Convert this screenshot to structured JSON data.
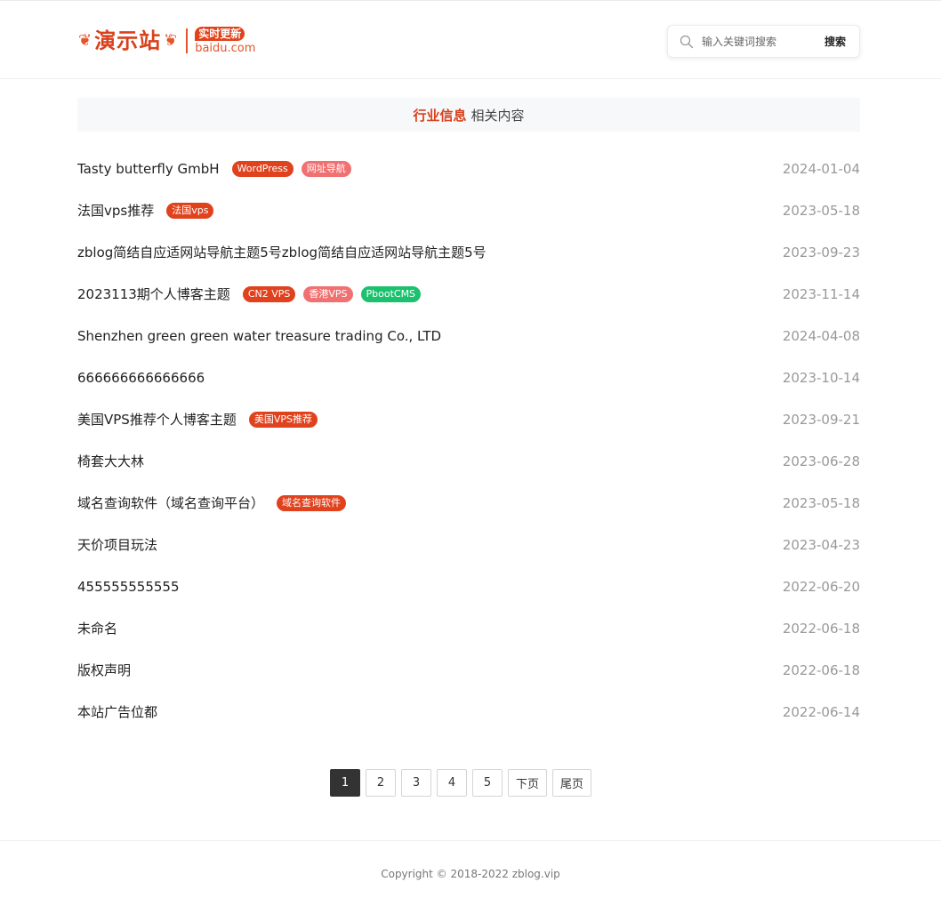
{
  "header": {
    "logo": {
      "text": "演示站",
      "badge": "实时更新",
      "domain": "baidu.com"
    },
    "search": {
      "placeholder": "输入关键词搜索",
      "button_label": "搜索"
    }
  },
  "section": {
    "title_accent": "行业信息",
    "title_rest": "相关内容"
  },
  "articles": [
    {
      "title": "Tasty butterfly GmbH",
      "tags": [
        {
          "label": "WordPress",
          "color": "#e0421d"
        },
        {
          "label": "网址导航",
          "color": "#f07171"
        }
      ],
      "date": "2024-01-04"
    },
    {
      "title": "法国vps推荐",
      "tags": [
        {
          "label": "法国vps",
          "color": "#e0421d"
        }
      ],
      "date": "2023-05-18"
    },
    {
      "title": "zblog简结自应适网站导航主题5号zblog简结自应适网站导航主题5号",
      "tags": [],
      "date": "2023-09-23"
    },
    {
      "title": "2023113期个人博客主题",
      "tags": [
        {
          "label": "CN2 VPS",
          "color": "#e0421d"
        },
        {
          "label": "香港VPS",
          "color": "#f07171"
        },
        {
          "label": "PbootCMS",
          "color": "#1cc16e"
        }
      ],
      "date": "2023-11-14"
    },
    {
      "title": "Shenzhen green green water treasure trading Co., LTD",
      "tags": [],
      "date": "2024-04-08"
    },
    {
      "title": "666666666666666",
      "tags": [],
      "date": "2023-10-14"
    },
    {
      "title": "美国VPS推荐个人博客主题",
      "tags": [
        {
          "label": "美国VPS推荐",
          "color": "#e0421d"
        }
      ],
      "date": "2023-09-21"
    },
    {
      "title": "椅套大大林",
      "tags": [],
      "date": "2023-06-28"
    },
    {
      "title": "域名查询软件（域名查询平台）",
      "tags": [
        {
          "label": "域名查询软件",
          "color": "#e0421d"
        }
      ],
      "date": "2023-05-18"
    },
    {
      "title": "天价项目玩法",
      "tags": [],
      "date": "2023-04-23"
    },
    {
      "title": "455555555555",
      "tags": [],
      "date": "2022-06-20"
    },
    {
      "title": "未命名",
      "tags": [],
      "date": "2022-06-18"
    },
    {
      "title": "版权声明",
      "tags": [],
      "date": "2022-06-18"
    },
    {
      "title": "本站广告位都",
      "tags": [],
      "date": "2022-06-14"
    }
  ],
  "pagination": {
    "pages": [
      "1",
      "2",
      "3",
      "4",
      "5"
    ],
    "active": "1",
    "next_label": "下页",
    "last_label": "尾页"
  },
  "footer": {
    "copyright": "Copyright © 2018-2022 zblog.vip"
  },
  "colors": {
    "accent": "#d9411d",
    "date": "#999999",
    "page_active": "#333333"
  }
}
